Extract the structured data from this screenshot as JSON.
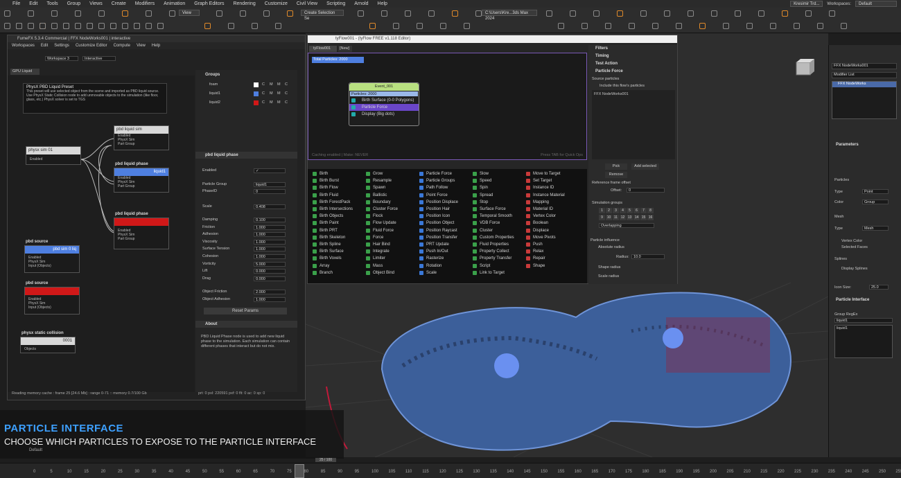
{
  "menu": [
    "File",
    "Edit",
    "Tools",
    "Group",
    "Views",
    "Create",
    "Modifiers",
    "Animation",
    "Graph Editors",
    "Rendering",
    "Customize",
    "Civil View",
    "Scripting",
    "Arnold",
    "Help"
  ],
  "top": {
    "user": "Kresimir Trd...",
    "workspaces_label": "Workspaces:",
    "workspace": "Default",
    "view_dd": "View",
    "selection_set": "Create Selection Se",
    "path": "C:\\Users\\Kre...3ds Max 2024"
  },
  "ffx": {
    "title": "FumeFX 5.3.4 Commercial | FFX NodeWorks001 | interactive",
    "menu": [
      "Workspaces",
      "Edit",
      "Settings",
      "Customize Editor",
      "Compute",
      "View",
      "Help"
    ],
    "workspace": "Workspace 3",
    "mode": "Interactive",
    "tab": "GPU Liquid",
    "preset_title": "PhysX PBD Liquid Preset",
    "preset_desc": "This preset will use selected object from the scene and imported as PBD liquid source. Use PhysX Static Collision node to add unmovable objects to the simulation (like floor, glass, etc.) PhysX solver is set to TGS",
    "nodes": {
      "sim": {
        "title": "physx sim 01",
        "p1": "Enabled",
        "p2": "PhysX"
      },
      "pbd_sim": {
        "title": "pbd liquid sim",
        "ports": [
          "Enabled",
          "PhysX Sim",
          "Part Group"
        ]
      },
      "phase1": {
        "title": "pbd liquid phase",
        "head": "liquid1",
        "ports": [
          "Enabled",
          "PhysX Sim",
          "Part Group"
        ]
      },
      "phase2": {
        "title": "pbd liquid phase",
        "ports": [
          "Enabled",
          "PhysX Sim",
          "Part Group"
        ]
      },
      "src1": {
        "title": "pbd source",
        "head": "pbd sim 0 liq",
        "ports": [
          "Enabled",
          "PhysX Sim",
          "Input (Objects)"
        ]
      },
      "src2": {
        "title": "pbd source",
        "ports": [
          "Enabled",
          "PhysX Sim",
          "Input (Objects)"
        ]
      },
      "col": {
        "title": "physx static collision",
        "head": "0001",
        "ports": [
          "Objects"
        ]
      }
    },
    "groups_title": "Groups",
    "groups": [
      {
        "name": "foam",
        "color": "#ffffff"
      },
      {
        "name": "liquid1",
        "color": "#4e7fe0"
      },
      {
        "name": "liquid2",
        "color": "#d01818"
      }
    ],
    "cmd": [
      "C",
      "M",
      "M",
      "C"
    ],
    "phase_title": "pbd liquid phase",
    "params": [
      {
        "l": "Enabled",
        "v": "✓"
      },
      {
        "l": "Particle Group",
        "v": "liquid1"
      },
      {
        "l": "PhaseID",
        "v": "0"
      },
      {
        "l": "Scale",
        "v": "0.408"
      },
      {
        "l": "Damping",
        "v": "0.100"
      },
      {
        "l": "Friction",
        "v": "1.000"
      },
      {
        "l": "Adhesion",
        "v": "1.000"
      },
      {
        "l": "Viscosity",
        "v": "1.000"
      },
      {
        "l": "Surface Tension",
        "v": "1.000"
      },
      {
        "l": "Cohesion",
        "v": "1.000"
      },
      {
        "l": "Vorticity",
        "v": "5.000"
      },
      {
        "l": "Lift",
        "v": "0.000"
      },
      {
        "l": "Drag",
        "v": "0.000"
      },
      {
        "l": "Object Friction",
        "v": "2.000"
      },
      {
        "l": "Object Adhesion",
        "v": "1.000"
      }
    ],
    "reset": "Reset Params",
    "about_title": "About",
    "about": "PBD Liquid Phase node is used to add new liquid phase to the simulation. Each simulation can contain different phases that interact but do not mix.",
    "status": "Reading memory cache : frame 25 [24.6 Mb] : range 0-71 :: memory 0.7/100 Gb",
    "status2": "prt: 0 pxl: 220591 pxf: 0 flt: 0 ac: 0 sp: 0"
  },
  "tyf": {
    "title": "tyFlow001 - (tyFlow FREE v1.118 Editor)",
    "tab1": "tyFlow001",
    "tab2": "[New]",
    "total": "Total Particles: 2000",
    "caching": "Caching enabled | Make: NEVER",
    "tip": "Press TAB for Quick Ops",
    "event": {
      "title": "Event_001",
      "count": "Particles: 2000",
      "ops": [
        "Birth Surface (0-0 Polygons)",
        "Particle Force",
        "Display (Big dots)"
      ]
    },
    "ops": [
      [
        "Birth",
        "Birth Burst",
        "Birth Flow",
        "Birth Fluid",
        "Birth ForestPack",
        "Birth Intersections",
        "Birth Objects",
        "Birth Paint",
        "Birth PRT",
        "Birth Skeleton",
        "Birth Spline",
        "Birth Surface",
        "Birth Voxels",
        "Array",
        "Branch"
      ],
      [
        "Grow",
        "Resample",
        "Spawn",
        "Ballistic",
        "Boundary",
        "Cluster Force",
        "Flock",
        "Flow Update",
        "Fluid Force",
        "Force",
        "Hair Bind",
        "Integrate",
        "Limiter",
        "Mass",
        "Object Bind"
      ],
      [
        "Particle Force",
        "Particle Groups",
        "Path Follow",
        "Point Force",
        "Position Displace",
        "Position Hair",
        "Position Icon",
        "Position Object",
        "Position Raycast",
        "Position Transfer",
        "PRT Update",
        "Push In/Out",
        "Rasterize",
        "Rotation",
        "Scale"
      ],
      [
        "Slow",
        "Speed",
        "Spin",
        "Spread",
        "Stop",
        "Surface Force",
        "Temporal Smooth",
        "VDB Force",
        "Cluster",
        "Custom Properties",
        "Fluid Properties",
        "Property Collect",
        "Property Transfer",
        "Script",
        "Link to Target"
      ],
      [
        "Move to Target",
        "Set Target",
        "Instance ID",
        "Instance Material",
        "Mapping",
        "Material ID",
        "Vertex Color",
        "Boolean",
        "Displace",
        "Move Pivots",
        "Push",
        "Relax",
        "Repair",
        "Shape"
      ]
    ],
    "side": {
      "filters": "Filters",
      "timing": "Timing",
      "test": "Test Action",
      "pf": "Particle Force",
      "src": "Source particles",
      "include": "Include this flow's particles",
      "obj": "FFX NodeWorks001",
      "pick": "Pick",
      "add": "Add selected",
      "remove": "Remove",
      "ref": "Reference frame offset",
      "offset_l": "Offset:",
      "offset": "0",
      "simgroups": "Simulation groups",
      "nums": [
        "1",
        "2",
        "3",
        "4",
        "5",
        "6",
        "7",
        "8",
        "9",
        "10",
        "11",
        "12",
        "13",
        "14",
        "15",
        "16"
      ],
      "overlap": "Overlapping",
      "infl": "Particle influence",
      "absr": "Absolute radius",
      "radius_l": "Radius:",
      "radius": "10.0",
      "shape": "Shape radius",
      "scale": "Scale radius"
    }
  },
  "rp": {
    "obj": "FFX NodeWorks001",
    "modlist": "Modifier List",
    "mod": "FFX NodeWorks",
    "params": "Parameters",
    "particles": "Particles",
    "type_l": "Type",
    "type": "Point",
    "color_l": "Color",
    "color": "Group",
    "mesh": "Mesh",
    "mtype_l": "Type",
    "mtype": "Mesh",
    "vc": "Vertex Color",
    "sf": "Selected Faces",
    "splines": "Splines",
    "ds": "Display Splines",
    "icon_l": "Icon Size:",
    "icon": "25.0",
    "pi": "Particle Interface",
    "grp_l": "Group RegEx",
    "grp": "liquid1",
    "list": "liquid1"
  },
  "caption": {
    "title": "PARTICLE INTERFACE",
    "sub": "CHOOSE WHICH PARTICLES TO EXPOSE TO THE PARTICLE INTERFACE"
  },
  "viewport": {
    "frame": "25 / 100",
    "default": "Default"
  },
  "timeline": [
    "0",
    "5",
    "10",
    "15",
    "20",
    "25",
    "30",
    "35",
    "40",
    "45",
    "50",
    "55",
    "60",
    "65",
    "70",
    "75",
    "80",
    "85",
    "90",
    "95",
    "100",
    "105",
    "110",
    "115",
    "120",
    "125",
    "130",
    "135",
    "140",
    "145",
    "150",
    "155",
    "160",
    "165",
    "170",
    "175",
    "180",
    "185",
    "190",
    "195",
    "200",
    "205",
    "210",
    "215",
    "220",
    "225",
    "230",
    "235",
    "240",
    "245",
    "250",
    "255",
    "260"
  ]
}
